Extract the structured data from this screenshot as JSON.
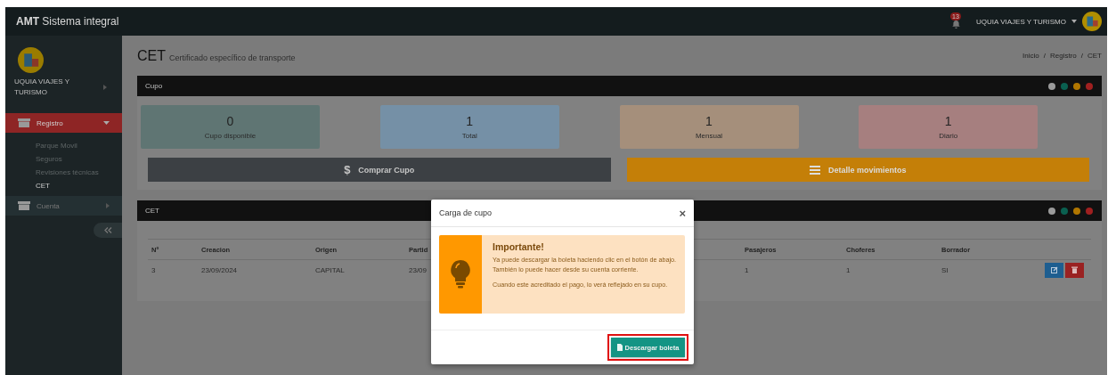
{
  "topbar": {
    "brand_bold": "AMT",
    "brand_rest": "Sistema integral",
    "notifications": "13",
    "user": "UQUIA VIAJES Y TURISMO"
  },
  "sidebar": {
    "user": "UQUIA VIAJES Y TURISMO",
    "items": [
      {
        "label": "Registro",
        "expanded": true,
        "selected": true,
        "children": [
          {
            "label": "Parque Movil",
            "selected": false
          },
          {
            "label": "Seguros",
            "selected": false
          },
          {
            "label": "Revisiones técnicas",
            "selected": false
          },
          {
            "label": "CET",
            "selected": true
          }
        ]
      },
      {
        "label": "Cuenta",
        "expanded": false,
        "selected": false
      }
    ]
  },
  "page": {
    "title": "CET",
    "subtitle": "Certificado específico de transporte",
    "breadcrumb": [
      "Inicio",
      "Registro",
      "CET"
    ],
    "separator": "/"
  },
  "cupo_panel": {
    "title": "Cupo",
    "stats": [
      {
        "value": "0",
        "label": "Cupo disponible",
        "color": "#5f7573"
      },
      {
        "value": "1",
        "label": "Total",
        "color": "#7590a6"
      },
      {
        "value": "1",
        "label": "Mensual",
        "color": "#a58f7b"
      },
      {
        "value": "1",
        "label": "Diario",
        "color": "#a67f7f"
      }
    ],
    "buttons": [
      {
        "kind": "dollar",
        "icon": "$",
        "label": "Comprar Cupo"
      },
      {
        "kind": "list",
        "label": "Detalle movimientos"
      }
    ]
  },
  "cet_panel": {
    "title": "CET",
    "columns": [
      "Nº",
      "Creacion",
      "Origen",
      "Partid",
      "",
      "Pasajeros",
      "Choferes",
      "Borrador"
    ],
    "rows": [
      [
        "3",
        "23/09/2024",
        "CAPITAL",
        "23/09",
        "",
        "1",
        "1",
        "SI"
      ]
    ]
  },
  "modal": {
    "title": "Carga de cupo",
    "close": "×",
    "alert_title": "Importante!",
    "alert_lines": [
      "Ya puede descargar la boleta haciendo clic en el botón de abajo. También lo puede hacer desde su cuenta corriente.",
      "Cuando este acreditado el pago, lo verá reflejado en su cupo."
    ],
    "button": "Descargar boleta"
  }
}
